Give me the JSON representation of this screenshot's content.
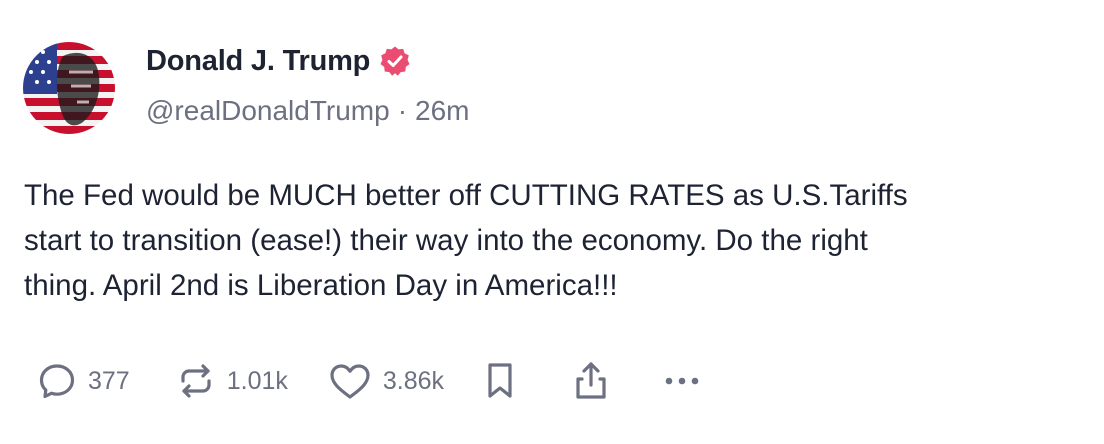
{
  "author": {
    "display_name": "Donald J. Trump",
    "handle": "@realDonaldTrump",
    "separator": "·",
    "timestamp": "26m",
    "verified": true
  },
  "post": {
    "lines": [
      "The Fed would be MUCH better off CUTTING RATES as U.S.Tariffs",
      "start to transition (ease!) their way into the economy. Do the right",
      "thing. April 2nd is Liberation Day in America!!!"
    ]
  },
  "actions": {
    "reply": {
      "icon": "reply-icon",
      "count": "377"
    },
    "repost": {
      "icon": "repost-icon",
      "count": "1.01k"
    },
    "like": {
      "icon": "heart-icon",
      "count": "3.86k"
    },
    "bookmark": {
      "icon": "bookmark-icon"
    },
    "share": {
      "icon": "share-icon"
    },
    "more": {
      "icon": "more-icon"
    }
  },
  "colors": {
    "text": "#1d2333",
    "muted": "#6c7080",
    "verified_badge": "#ea4c72"
  }
}
